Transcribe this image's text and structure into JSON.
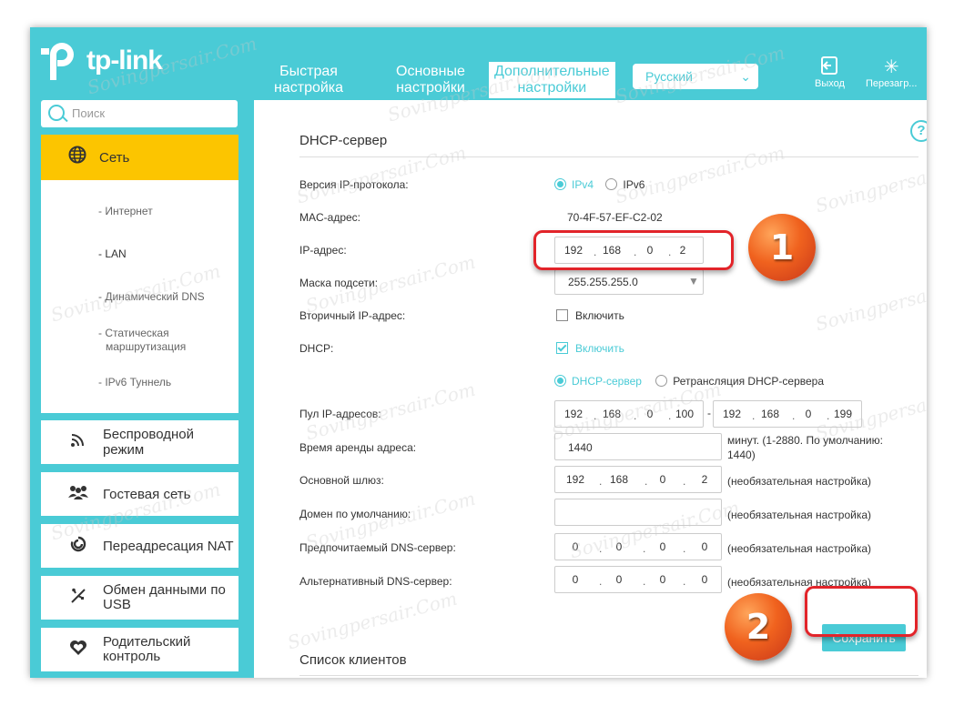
{
  "header": {
    "brand": "tp-link",
    "tabs": [
      {
        "label_line1": "Быстрая",
        "label_line2": "настройка"
      },
      {
        "label_line1": "Основные",
        "label_line2": "настройки"
      },
      {
        "label_line1": "Дополнительные",
        "label_line2": "настройки"
      }
    ],
    "language": "Русский",
    "logout_label": "Выход",
    "reboot_label": "Перезагр..."
  },
  "sidebar": {
    "search_placeholder": "Поиск",
    "active_section": "Сеть",
    "sub_items": [
      "- Интернет",
      "- LAN",
      "- Динамический DNS",
      "- Статическая",
      "маршрутизация",
      "- IPv6 Туннель"
    ],
    "items": [
      {
        "label": "Беспроводной режим"
      },
      {
        "label": "Гостевая сеть"
      },
      {
        "label": "Переадресация NAT"
      },
      {
        "label_line1": "Обмен данными по",
        "label_line2": "USB"
      },
      {
        "label_line1": "Родительский",
        "label_line2": "контроль"
      }
    ]
  },
  "main": {
    "section_title": "DHCP-сервер",
    "help_glyph": "?",
    "ip_version_label": "Версия IP-протокола:",
    "ipv4": "IPv4",
    "ipv6": "IPv6",
    "mac_label": "MAC-адрес:",
    "mac_value": "70-4F-57-EF-C2-02",
    "ip_label": "IP-адрес:",
    "ip": [
      "192",
      "168",
      "0",
      "2"
    ],
    "mask_label": "Маска подсети:",
    "mask_value": "255.255.255.0",
    "secondary_ip_label": "Вторичный IP-адрес:",
    "secondary_ip_check": "Включить",
    "dhcp_label": "DHCP:",
    "dhcp_check": "Включить",
    "dhcp_server_radio": "DHCP-сервер",
    "dhcp_relay_radio": "Ретрансляция DHCP-сервера",
    "pool_label": "Пул IP-адресов:",
    "pool_start": [
      "192",
      "168",
      "0",
      "100"
    ],
    "pool_dash": "-",
    "pool_end": [
      "192",
      "168",
      "0",
      "199"
    ],
    "lease_label": "Время аренды адреса:",
    "lease_value": "1440",
    "lease_note_line1": "минут. (1-2880. По умолчанию:",
    "lease_note_line2": "1440)",
    "gateway_label": "Основной шлюз:",
    "gateway": [
      "192",
      "168",
      "0",
      "2"
    ],
    "domain_label": "Домен по умолчанию:",
    "dns1_label": "Предпочитаемый DNS-сервер:",
    "dns1": [
      "0",
      "0",
      "0",
      "0"
    ],
    "dns2_label": "Альтернативный DNS-сервер:",
    "dns2": [
      "0",
      "0",
      "0",
      "0"
    ],
    "optional_note": "(необязательная настройка)",
    "save_label": "Сохранить",
    "clients_title": "Список клиентов"
  },
  "annotations": {
    "badge1": "1",
    "badge2": "2"
  },
  "watermark": "Sovingpersair.Com",
  "colors": {
    "accent": "#4acbd6",
    "active_section": "#fcc500",
    "highlight": "#e2242a"
  }
}
